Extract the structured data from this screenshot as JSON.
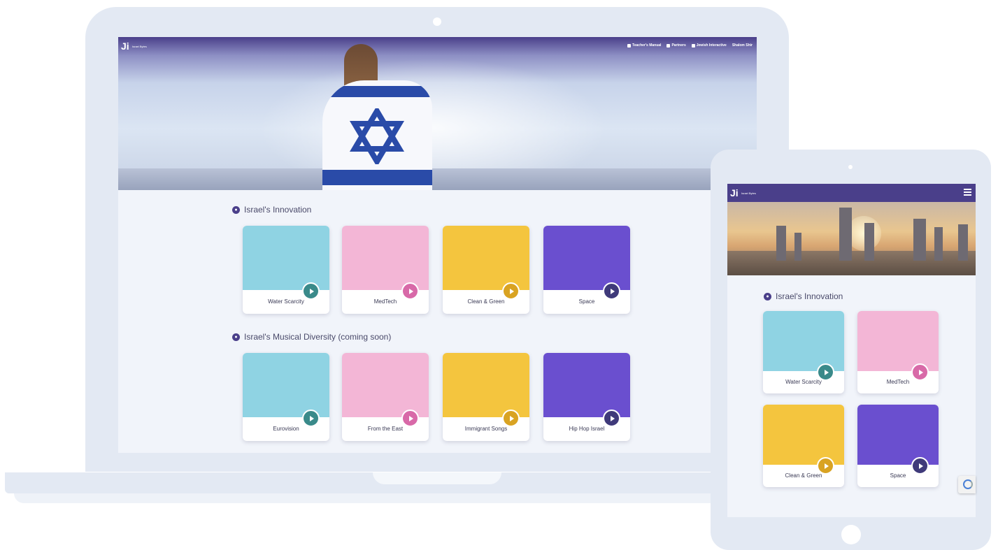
{
  "laptop": {
    "nav": [
      {
        "icon": "book-icon",
        "label": "Teacher's Manual"
      },
      {
        "icon": "handshake-icon",
        "label": "Partners"
      },
      {
        "icon": "ji-logo-icon",
        "label": "Jewish Interactive"
      },
      {
        "icon": "",
        "label": "Shalom Shir"
      }
    ],
    "logo_text": "Israel Bytes",
    "sections": [
      {
        "title": "Israel's Innovation",
        "icon": "lightbulb-icon",
        "cards": [
          {
            "label": "Water Scarcity",
            "color": "#8fd3e3",
            "accent": "#3a8a8a"
          },
          {
            "label": "MedTech",
            "color": "#f3b6d6",
            "accent": "#d869a8"
          },
          {
            "label": "Clean & Green",
            "color": "#f4c53e",
            "accent": "#d9a322"
          },
          {
            "label": "Space",
            "color": "#6a4fcf",
            "accent": "#3f3a7a"
          }
        ]
      },
      {
        "title": "Israel's Musical Diversity (coming soon)",
        "icon": "music-icon",
        "cards": [
          {
            "label": "Eurovision",
            "color": "#8fd3e3",
            "accent": "#3a8a8a"
          },
          {
            "label": "From the East",
            "color": "#f3b6d6",
            "accent": "#d869a8"
          },
          {
            "label": "Immigrant Songs",
            "color": "#f4c53e",
            "accent": "#d9a322"
          },
          {
            "label": "Hip Hop Israel",
            "color": "#6a4fcf",
            "accent": "#3f3a7a"
          }
        ]
      }
    ]
  },
  "tablet": {
    "logo_text": "Israel Bytes",
    "section_title": "Israel's Innovation",
    "cards": [
      {
        "label": "Water Scarcity",
        "color": "#8fd3e3",
        "accent": "#3a8a8a"
      },
      {
        "label": "MedTech",
        "color": "#f3b6d6",
        "accent": "#d869a8"
      },
      {
        "label": "Clean & Green",
        "color": "#f4c53e",
        "accent": "#d9a322"
      },
      {
        "label": "Space",
        "color": "#6a4fcf",
        "accent": "#3f3a7a"
      }
    ]
  },
  "colors": {
    "brand": "#4a3f8a",
    "device": "#e3e9f3"
  }
}
